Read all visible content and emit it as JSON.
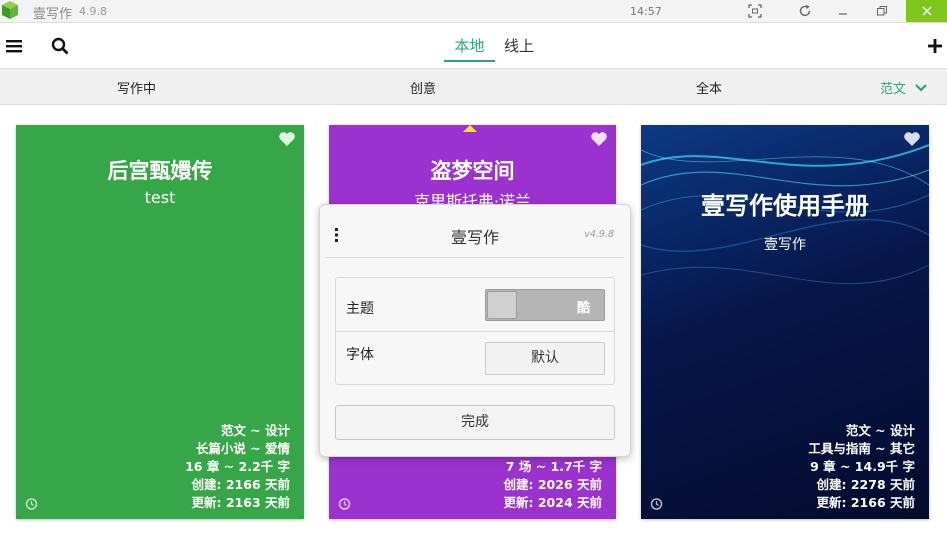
{
  "window": {
    "title": "壹写作",
    "version": "4.9.8",
    "clock": "14:57"
  },
  "toolbar": {
    "tabs": [
      {
        "label": "本地",
        "active": true
      },
      {
        "label": "线上",
        "active": false
      }
    ]
  },
  "categories": [
    {
      "label": "写作中",
      "active": false
    },
    {
      "label": "创意",
      "active": false
    },
    {
      "label": "全本",
      "active": false
    },
    {
      "label": "范文",
      "active": true
    }
  ],
  "colors": {
    "accent": "#2aa67c",
    "card_green": "#37a648",
    "card_purple": "#9b32cf",
    "card_navy": "#0a1a4a",
    "close_button": "#7ec51e"
  },
  "cards": [
    {
      "title": "后宫甄嬛传",
      "author": "test",
      "meta": [
        "范文 ~ 设计",
        "长篇小说 ~ 爱情",
        "16 章 ~ 2.2千 字",
        "创建: 2166 天前",
        "更新: 2163 天前"
      ]
    },
    {
      "title": "盗梦空间",
      "author": "克里斯托弗·诺兰",
      "meta": [
        "7 场 ~ 1.7千 字",
        "创建: 2026 天前",
        "更新: 2024 天前"
      ]
    },
    {
      "title": "壹写作使用手册",
      "author": "壹写作",
      "meta": [
        "范文 ~ 设计",
        "工具与指南 ~ 其它",
        "9 章 ~ 14.9千 字",
        "创建: 2278 天前",
        "更新: 2166 天前"
      ]
    }
  ],
  "dialog": {
    "title": "壹写作",
    "version": "v4.9.8",
    "theme_label": "主题",
    "theme_value": "酷",
    "font_label": "字体",
    "font_value": "默认",
    "done_label": "完成"
  }
}
